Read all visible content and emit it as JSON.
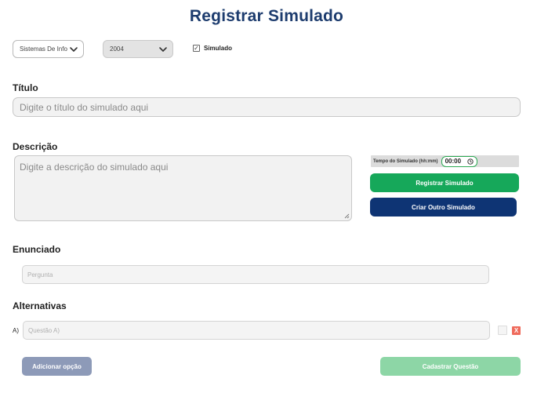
{
  "header": {
    "title": "Registrar Simulado"
  },
  "filters": {
    "course_select": "Sistemas De Info",
    "year_select": "2004",
    "simulado_checkbox_label": "Simulado",
    "simulado_checked": true,
    "check_glyph": "✓"
  },
  "title_section": {
    "label": "Título",
    "placeholder": "Digite o título do simulado aqui"
  },
  "description_section": {
    "label": "Descrição",
    "placeholder": "Digite a descrição do simulado aqui"
  },
  "timer": {
    "label": "Tempo do Simulado (hh:mm)",
    "value": "00:00"
  },
  "actions": {
    "register_label": "Registrar Simulado",
    "create_other_label": "Criar Outro Simulado",
    "add_option_label": "Adicionar opção",
    "submit_question_label": "Cadastrar Questão"
  },
  "statement_section": {
    "label": "Enunciado",
    "placeholder": "Pergunta"
  },
  "alternatives_section": {
    "label": "Alternativas",
    "items": [
      {
        "letter": "A)",
        "placeholder": "Questão A)",
        "delete_label": "X"
      }
    ]
  },
  "colors": {
    "title_blue": "#1d3c6e",
    "green": "#16a85a",
    "navy": "#0e3474",
    "slate": "#8d9ab8",
    "mint": "#8dd6a6",
    "delete_red": "#ef6b5c"
  },
  "icons": {
    "select_chevron": "chevron-down-icon",
    "clock": "clock-icon",
    "resize": "resize-grip-icon"
  }
}
